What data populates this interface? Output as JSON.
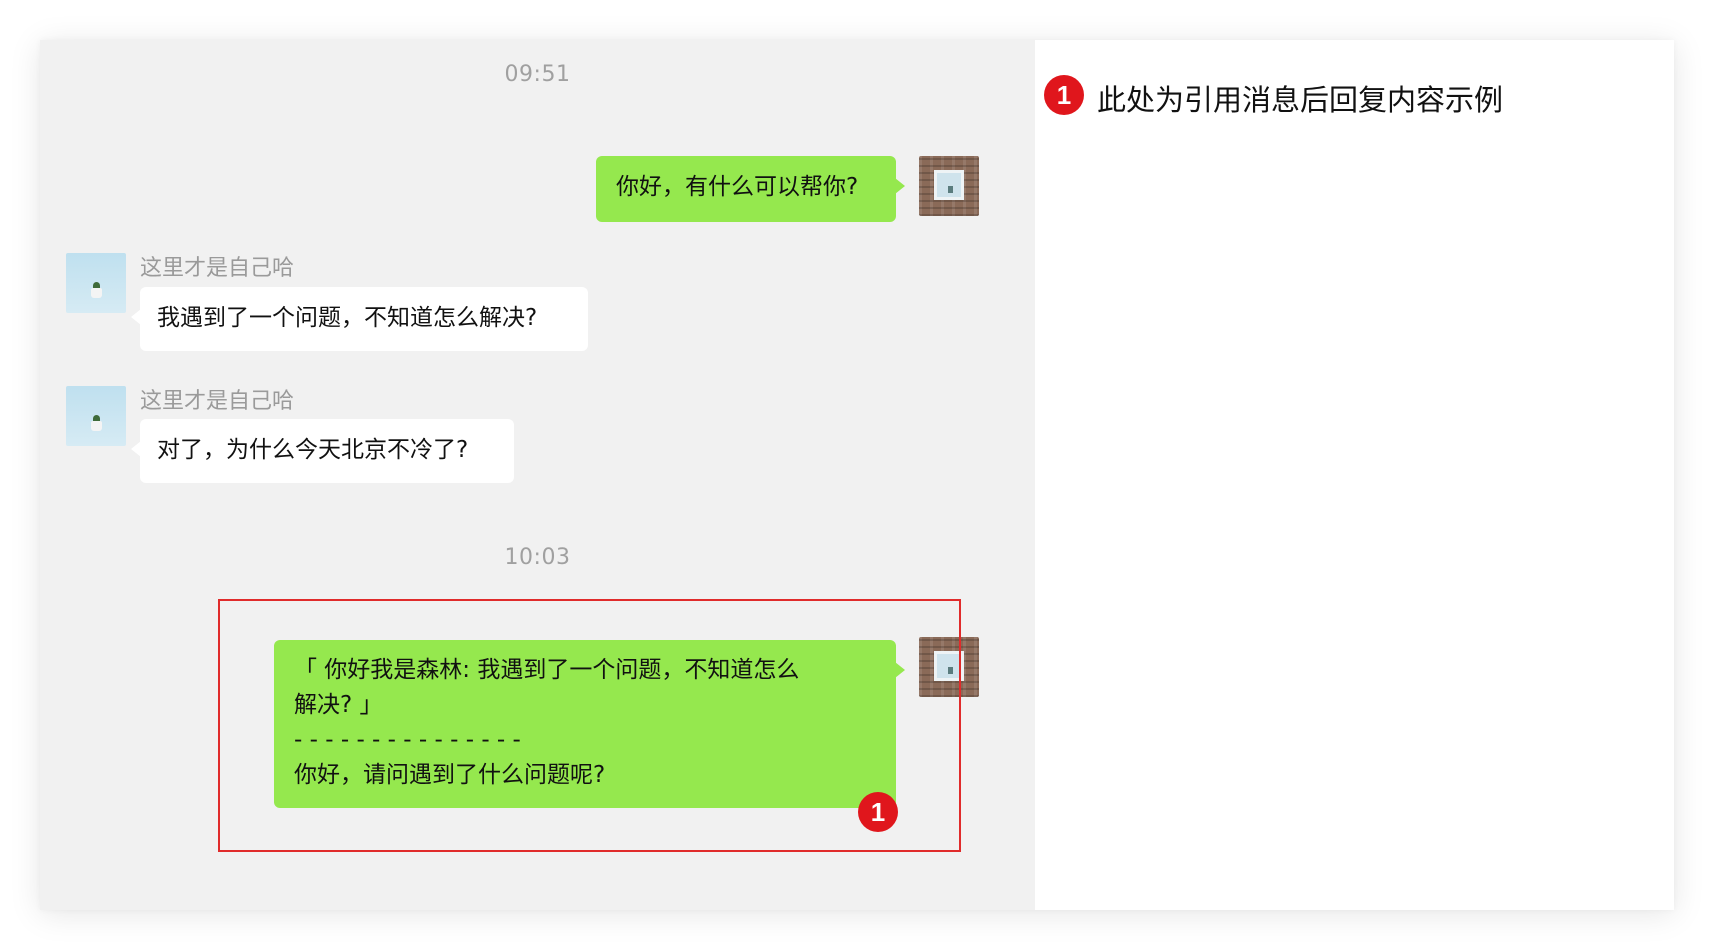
{
  "chat": {
    "timestamps": [
      "09:51",
      "10:03"
    ],
    "messages": [
      {
        "sender": "self",
        "text": "你好，有什么可以帮你?"
      },
      {
        "sender": "other",
        "name": "这里才是自己哈",
        "text": "我遇到了一个问题，不知道怎么解决?"
      },
      {
        "sender": "other",
        "name": "这里才是自己哈",
        "text": "对了，为什么今天北京不冷了?"
      },
      {
        "sender": "self",
        "quote": {
          "line1": "「 你好我是森林: 我遇到了一个问题，不知道怎么",
          "line2": "解决? 」",
          "divider": "- - - - - - - - - - - - - - -",
          "reply": "你好，请问遇到了什么问题呢?"
        }
      }
    ]
  },
  "annotation": {
    "marker": "1",
    "note": "此处为引用消息后回复内容示例",
    "box_color": "#e02b2b",
    "marker_color": "#e0161c"
  },
  "colors": {
    "self_bubble": "#95e84e",
    "other_bubble": "#ffffff",
    "chat_background": "#f1f1f1"
  }
}
